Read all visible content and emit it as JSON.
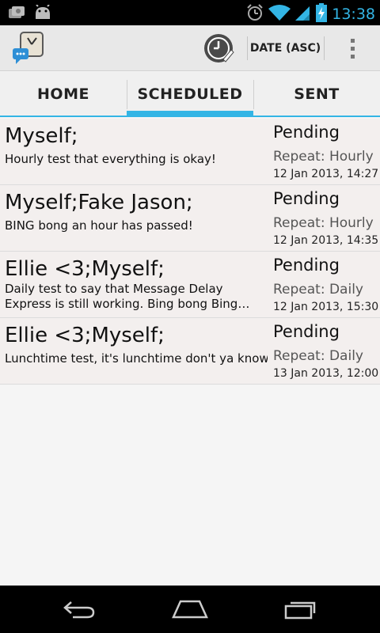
{
  "status_bar": {
    "time": "13:38",
    "icons": [
      "photo-notification-icon",
      "android-notification-icon",
      "alarm-icon",
      "wifi-icon",
      "signal-icon",
      "battery-charging-icon"
    ]
  },
  "action_bar": {
    "app_icon": "message-clock-icon",
    "timezone_icon": "clock-edit-icon",
    "sort_label": "DATE (ASC)",
    "overflow_icon": "overflow-menu-icon"
  },
  "tabs": [
    {
      "label": "HOME",
      "selected": false
    },
    {
      "label": "SCHEDULED",
      "selected": true
    },
    {
      "label": "SENT",
      "selected": false
    }
  ],
  "messages": [
    {
      "recipients": "Myself;",
      "text": "Hourly test that everything is okay!",
      "status": "Pending",
      "repeat": "Repeat: Hourly",
      "date": "12 Jan 2013, 14:27"
    },
    {
      "recipients": "Myself;Fake Jason;",
      "text": "BING bong an hour has passed!",
      "status": "Pending",
      "repeat": "Repeat: Hourly",
      "date": "12 Jan 2013, 14:35"
    },
    {
      "recipients": "Ellie <3;Myself;",
      "text": "Daily test to say that Message Delay Express is still working. Bing bong Bing bong carry o...",
      "status": "Pending",
      "repeat": "Repeat: Daily",
      "date": "12 Jan 2013, 15:30"
    },
    {
      "recipients": "Ellie <3;Myself;",
      "text": "Lunchtime test, it's lunchtime don't ya know?!",
      "status": "Pending",
      "repeat": "Repeat: Daily",
      "date": "13 Jan 2013, 12:00"
    }
  ],
  "nav_bar": {
    "icons": [
      "back-icon",
      "home-icon",
      "recent-apps-icon"
    ]
  },
  "colors": {
    "accent": "#33b5e5",
    "row_background": "#f3efee"
  }
}
